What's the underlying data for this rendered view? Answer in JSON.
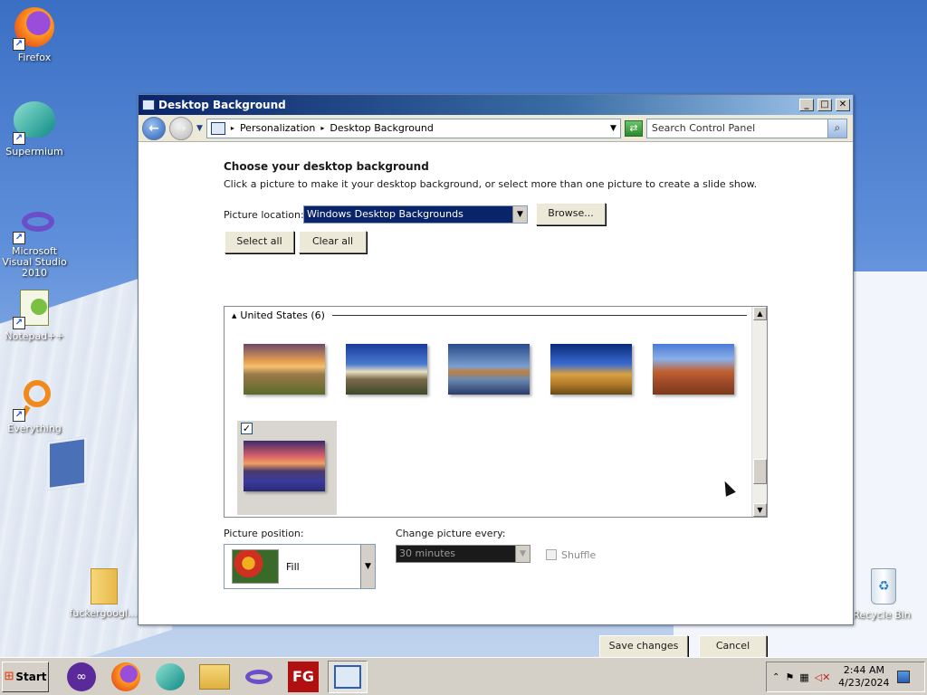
{
  "desktop": {
    "icons": [
      {
        "label": "Firefox"
      },
      {
        "label": "Supermium"
      },
      {
        "label": "Microsoft Visual Studio 2010"
      },
      {
        "label": "Notepad++"
      },
      {
        "label": "Everything"
      },
      {
        "label": "fuckergoogl..."
      },
      {
        "label": "Recycle Bin"
      }
    ]
  },
  "window": {
    "title": "Desktop Background",
    "controls": {
      "minimize": "_",
      "maximize": "□",
      "close": "✕"
    },
    "breadcrumb": [
      "Personalization",
      "Desktop Background"
    ],
    "search_placeholder": "Search Control Panel"
  },
  "main": {
    "heading": "Choose your desktop background",
    "description": "Click a picture to make it your desktop background, or select more than one picture to create a slide show.",
    "picture_location_label": "Picture location:",
    "picture_location_value": "Windows Desktop Backgrounds",
    "browse_label": "Browse...",
    "select_all_label": "Select all",
    "clear_all_label": "Clear all",
    "group_label": "United States (6)",
    "thumbnails": [
      {
        "name": "sunset-field"
      },
      {
        "name": "lighthouse"
      },
      {
        "name": "sea-rock"
      },
      {
        "name": "hay-bale"
      },
      {
        "name": "delicate-arch"
      },
      {
        "name": "lupine-lake",
        "selected": true
      }
    ],
    "picture_position_label": "Picture position:",
    "picture_position_value": "Fill",
    "change_every_label": "Change picture every:",
    "change_every_value": "30 minutes",
    "shuffle_label": "Shuffle",
    "save_label": "Save changes",
    "cancel_label": "Cancel"
  },
  "taskbar": {
    "start_label": "Start",
    "time": "2:44 AM",
    "date": "4/23/2024"
  }
}
